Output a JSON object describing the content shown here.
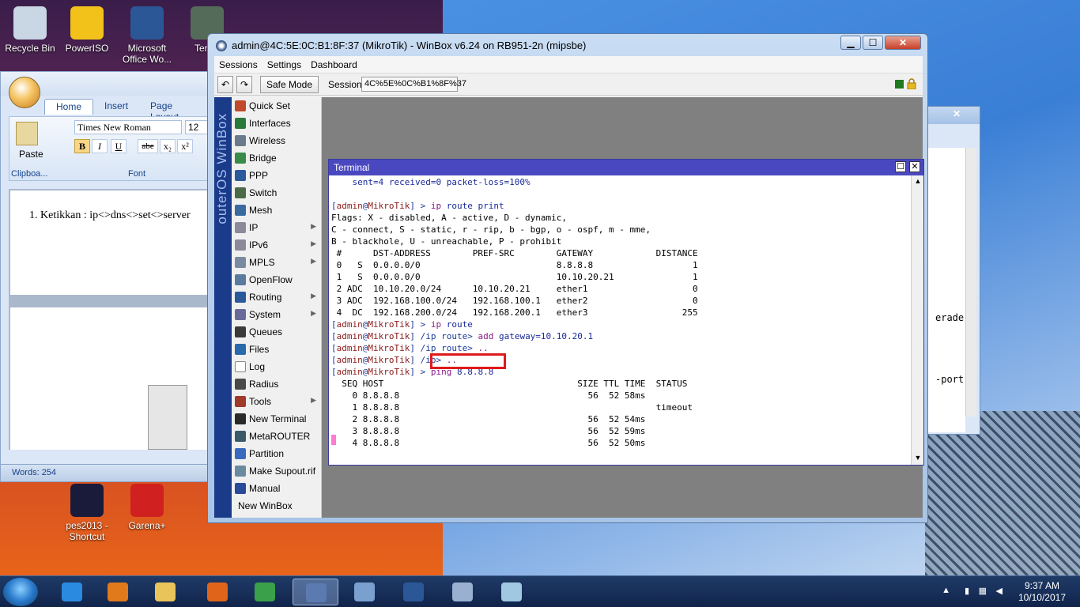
{
  "desktop": {
    "icons": [
      {
        "label": "Recycle Bin",
        "color": "#c9d6e3"
      },
      {
        "label": "PowerISO",
        "color": "#f2c21a"
      },
      {
        "label": "Microsoft\nOffice Wo...",
        "color": "#2b5797"
      },
      {
        "label": "TeraC",
        "color": "#556b5a"
      },
      {
        "label": "pes2013 -\nShortcut",
        "color": "#1a1a3a"
      },
      {
        "label": "Garena+",
        "color": "#d02020"
      }
    ]
  },
  "word": {
    "tabs": [
      "Home",
      "Insert",
      "Page Layout"
    ],
    "font_name": "Times New Roman",
    "font_size": "12",
    "format_buttons": [
      "B",
      "I",
      "U",
      "abe",
      "x₂",
      "x²"
    ],
    "paste_label": "Paste",
    "clipboard_label": "Clipboa...",
    "font_group_label": "Font",
    "doc_text": "1.  Ketikkan : ip<>dns<>set<>server",
    "status": "Words: 254"
  },
  "backwin": {
    "texts": [
      "erade",
      "-port"
    ]
  },
  "winbox": {
    "title": "admin@4C:5E:0C:B1:8F:37 (MikroTik) - WinBox v6.24 on RB951-2n (mipsbe)",
    "menu": [
      "Sessions",
      "Settings",
      "Dashboard"
    ],
    "safe_mode": "Safe Mode",
    "session_label": "Session:",
    "session_value": "4C%5E%0C%B1%8F%37",
    "band_text": "outerOS WinBox",
    "nav": [
      {
        "label": "Quick Set",
        "icon": "quick-set-icon",
        "color": "#c04a2a",
        "arrow": false
      },
      {
        "label": "Interfaces",
        "icon": "interfaces-icon",
        "color": "#2a7a3a",
        "arrow": false
      },
      {
        "label": "Wireless",
        "icon": "wireless-icon",
        "color": "#6a7a8a",
        "arrow": false
      },
      {
        "label": "Bridge",
        "icon": "bridge-icon",
        "color": "#3a8a4a",
        "arrow": false
      },
      {
        "label": "PPP",
        "icon": "ppp-icon",
        "color": "#2a5a9a",
        "arrow": false
      },
      {
        "label": "Switch",
        "icon": "switch-icon",
        "color": "#4a6a4a",
        "arrow": false
      },
      {
        "label": "Mesh",
        "icon": "mesh-icon",
        "color": "#3a6aa0",
        "arrow": false
      },
      {
        "label": "IP",
        "icon": "ip-icon",
        "color": "#8a8a9a",
        "arrow": true
      },
      {
        "label": "IPv6",
        "icon": "ipv6-icon",
        "color": "#8a8a9a",
        "arrow": true
      },
      {
        "label": "MPLS",
        "icon": "mpls-icon",
        "color": "#7a8aa0",
        "arrow": true
      },
      {
        "label": "OpenFlow",
        "icon": "openflow-icon",
        "color": "#5a7aa0",
        "arrow": false
      },
      {
        "label": "Routing",
        "icon": "routing-icon",
        "color": "#2a5a9a",
        "arrow": true
      },
      {
        "label": "System",
        "icon": "system-icon",
        "color": "#6a6a9a",
        "arrow": true
      },
      {
        "label": "Queues",
        "icon": "queues-icon",
        "color": "#3a3a3a",
        "arrow": false
      },
      {
        "label": "Files",
        "icon": "files-icon",
        "color": "#2a6aaa",
        "arrow": false
      },
      {
        "label": "Log",
        "icon": "log-icon",
        "color": "#ffffff",
        "arrow": false
      },
      {
        "label": "Radius",
        "icon": "radius-icon",
        "color": "#4a4a4a",
        "arrow": false
      },
      {
        "label": "Tools",
        "icon": "tools-icon",
        "color": "#a03a2a",
        "arrow": true
      },
      {
        "label": "New Terminal",
        "icon": "terminal-icon",
        "color": "#2a2a2a",
        "arrow": false
      },
      {
        "label": "MetaROUTER",
        "icon": "metarouter-icon",
        "color": "#3a5a6a",
        "arrow": false
      },
      {
        "label": "Partition",
        "icon": "partition-icon",
        "color": "#3a6ac0",
        "arrow": false
      },
      {
        "label": "Make Supout.rif",
        "icon": "supout-icon",
        "color": "#6a8aa0",
        "arrow": false
      },
      {
        "label": "Manual",
        "icon": "manual-icon",
        "color": "#2a4a9a",
        "arrow": false
      },
      {
        "label": "New WinBox",
        "icon": "",
        "color": "",
        "arrow": false
      }
    ],
    "terminal": {
      "title": "Terminal",
      "lines": [
        {
          "prompt": "",
          "cmd": "",
          "text": "    sent=4 received=0 packet-loss=100%",
          "cls": "bl"
        },
        {
          "prompt": "",
          "cmd": "",
          "text": "",
          "cls": ""
        },
        {
          "prompt": "[admin@MikroTik] > ",
          "cmd": "ip route print",
          "text": "",
          "cls": ""
        },
        {
          "prompt": "",
          "cmd": "",
          "text": "Flags: X - disabled, A - active, D - dynamic,",
          "cls": ""
        },
        {
          "prompt": "",
          "cmd": "",
          "text": "C - connect, S - static, r - rip, b - bgp, o - ospf, m - mme,",
          "cls": ""
        },
        {
          "prompt": "",
          "cmd": "",
          "text": "B - blackhole, U - unreachable, P - prohibit",
          "cls": ""
        },
        {
          "prompt": "",
          "cmd": "",
          "text": " #      DST-ADDRESS        PREF-SRC        GATEWAY            DISTANCE",
          "cls": ""
        },
        {
          "prompt": "",
          "cmd": "",
          "text": " 0   S  0.0.0.0/0                          8.8.8.8                   1",
          "cls": ""
        },
        {
          "prompt": "",
          "cmd": "",
          "text": " 1   S  0.0.0.0/0                          10.10.20.21               1",
          "cls": ""
        },
        {
          "prompt": "",
          "cmd": "",
          "text": " 2 ADC  10.10.20.0/24      10.10.20.21     ether1                    0",
          "cls": ""
        },
        {
          "prompt": "",
          "cmd": "",
          "text": " 3 ADC  192.168.100.0/24   192.168.100.1   ether2                    0",
          "cls": ""
        },
        {
          "prompt": "",
          "cmd": "",
          "text": " 4  DC  192.168.200.0/24   192.168.200.1   ether3                  255",
          "cls": ""
        },
        {
          "prompt": "[admin@MikroTik] > ",
          "cmd": "ip route",
          "text": "",
          "cls": ""
        },
        {
          "prompt": "[admin@MikroTik] /ip route> ",
          "cmd": "add gateway=10.10.20.1",
          "text": "",
          "cls": ""
        },
        {
          "prompt": "[admin@MikroTik] /ip route> ",
          "cmd": "..",
          "text": "",
          "cls": ""
        },
        {
          "prompt": "[admin@MikroTik] /ip> ",
          "cmd": "..",
          "text": "",
          "cls": ""
        },
        {
          "prompt": "[admin@MikroTik] > ",
          "cmd": "ping 8.8.8.8",
          "text": "",
          "cls": ""
        },
        {
          "prompt": "",
          "cmd": "",
          "text": "  SEQ HOST                                     SIZE TTL TIME  STATUS",
          "cls": ""
        },
        {
          "prompt": "",
          "cmd": "",
          "text": "    0 8.8.8.8                                    56  52 58ms",
          "cls": ""
        },
        {
          "prompt": "",
          "cmd": "",
          "text": "    1 8.8.8.8                                                 timeout",
          "cls": ""
        },
        {
          "prompt": "",
          "cmd": "",
          "text": "    2 8.8.8.8                                    56  52 54ms",
          "cls": ""
        },
        {
          "prompt": "",
          "cmd": "",
          "text": "    3 8.8.8.8                                    56  52 59ms",
          "cls": ""
        },
        {
          "prompt": "",
          "cmd": "",
          "text": "    4 8.8.8.8                                    56  52 50ms",
          "cls": ""
        }
      ]
    }
  },
  "taskbar": {
    "apps": [
      {
        "name": "ie",
        "color": "#2a8ae0",
        "active": false
      },
      {
        "name": "media-player",
        "color": "#e07a1a",
        "active": false
      },
      {
        "name": "explorer",
        "color": "#e8c45a",
        "active": false
      },
      {
        "name": "firefox",
        "color": "#e0651a",
        "active": false
      },
      {
        "name": "chrome",
        "color": "#3aa04a",
        "active": false
      },
      {
        "name": "winbox",
        "color": "#5a7ab0",
        "active": true
      },
      {
        "name": "network",
        "color": "#7aa0d0",
        "active": false
      },
      {
        "name": "word",
        "color": "#2b5797",
        "active": false
      },
      {
        "name": "paint",
        "color": "#9ab0d0",
        "active": false
      },
      {
        "name": "notes",
        "color": "#a0c8e0",
        "active": false
      }
    ],
    "time": "9:37 AM",
    "date": "10/10/2017"
  }
}
